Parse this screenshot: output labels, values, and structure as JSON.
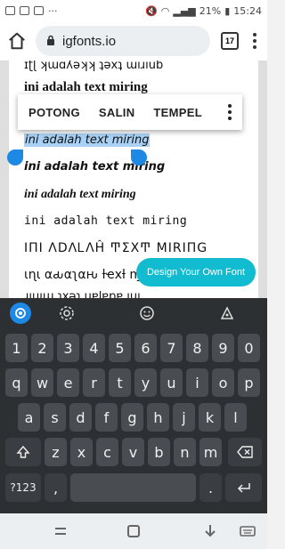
{
  "status": {
    "battery": "21%",
    "time": "15:24"
  },
  "browser": {
    "url": "igfonts.io",
    "tab_count": "17"
  },
  "page": {
    "lines": [
      "ɪʈɭ ʞɯɑʎǝʞʞ ʇǝxʇ ɯıɹıuƃ",
      "ini adalah text miring",
      "ini adalah text miring",
      "ini adalah text miring",
      "ini adalah text miring",
      "ini adalah text miring",
      "ΙΠΙ ΛDΛᏞΛĤ ͲΣXͲ MIRIΠG",
      "ιɳι αԃαʅαԋ ƚҽxƚ ɱιɾιɳɠ",
      "ɹıuıɯ ʇxǝʇ ɥɐlɐpɐ ıuı"
    ]
  },
  "context_menu": {
    "cut": "POTONG",
    "copy": "SALIN",
    "paste": "TEMPEL"
  },
  "cta": {
    "label": "Design Your Own Font"
  },
  "keyboard": {
    "row_numbers": [
      "1",
      "2",
      "3",
      "4",
      "5",
      "6",
      "7",
      "8",
      "9",
      "0"
    ],
    "row1": [
      "q",
      "w",
      "e",
      "r",
      "t",
      "y",
      "u",
      "i",
      "o",
      "p"
    ],
    "row2": [
      "a",
      "s",
      "d",
      "f",
      "g",
      "h",
      "j",
      "k",
      "l"
    ],
    "row3": [
      "z",
      "x",
      "c",
      "v",
      "b",
      "n",
      "m"
    ],
    "sym_label": "?123",
    "comma": ",",
    "period": "."
  },
  "colors": {
    "accent": "#1e88e5",
    "cta": "#12bcd0",
    "selection": "#a8d1f5",
    "keyboard_bg": "#2d3033",
    "key_bg": "#494c50"
  }
}
